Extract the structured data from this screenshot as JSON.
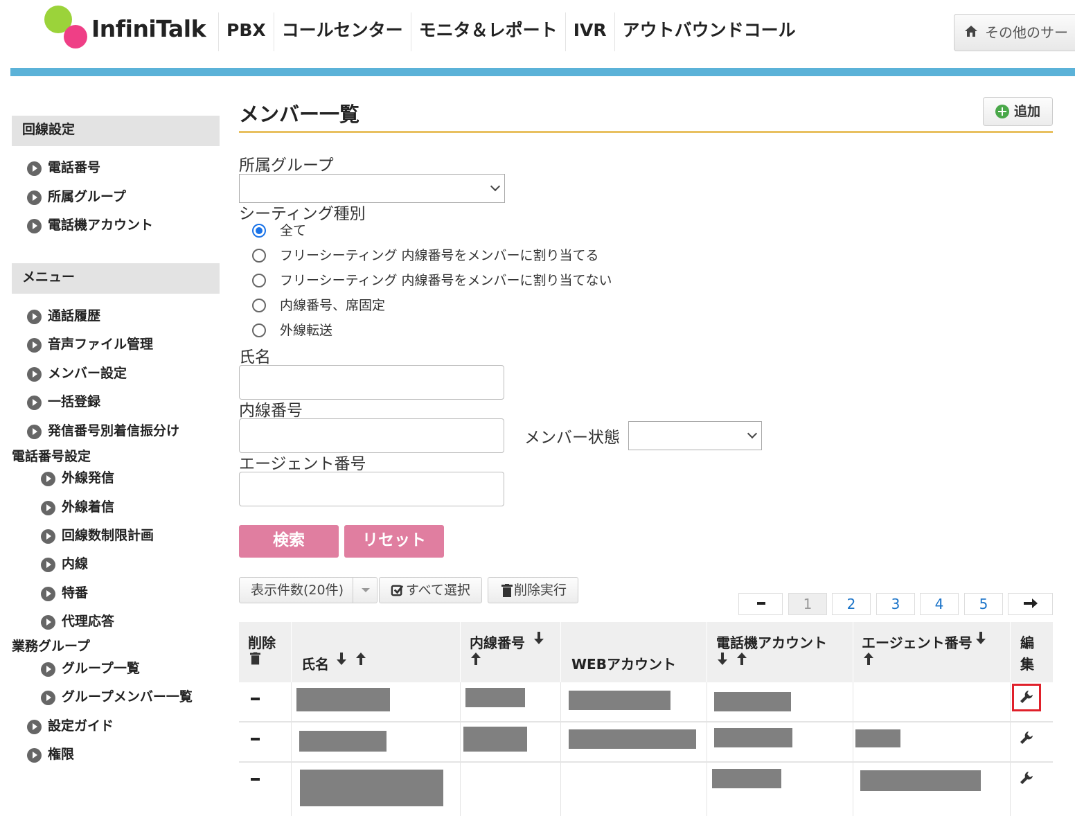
{
  "header": {
    "logo_text": "InfiniTalk",
    "nav": [
      "PBX",
      "コールセンター",
      "モニタ＆レポート",
      "IVR",
      "アウトバウンドコール"
    ],
    "other_services": "その他のサー"
  },
  "sidebar": {
    "section1_title": "回線設定",
    "section1_items": [
      "電話番号",
      "所属グループ",
      "電話機アカウント"
    ],
    "section2_title": "メニュー",
    "menu_items": [
      "通話履歴",
      "音声ファイル管理",
      "メンバー設定",
      "一括登録",
      "発信番号別着信振分け"
    ],
    "group_phone": "電話番号設定",
    "phone_items": [
      "外線発信",
      "外線着信",
      "回線数制限計画",
      "内線",
      "特番",
      "代理応答"
    ],
    "group_work": "業務グループ",
    "work_items": [
      "グループ一覧",
      "グループメンバー一覧"
    ],
    "bottom_items": [
      "設定ガイド",
      "権限"
    ]
  },
  "main": {
    "title": "メンバー一覧",
    "add_label": "追加",
    "group_label": "所属グループ",
    "seating_label": "シーティング種別",
    "seating_options": [
      "全て",
      "フリーシーティング 内線番号をメンバーに割り当てる",
      "フリーシーティング 内線番号をメンバーに割り当てない",
      "内線番号、席固定",
      "外線転送"
    ],
    "seating_selected": 0,
    "name_label": "氏名",
    "ext_label": "内線番号",
    "status_label": "メンバー状態",
    "agent_label": "エージェント番号",
    "search_button": "検索",
    "reset_button": "リセット",
    "display_count": "表示件数(20件)",
    "select_all": "すべて選択",
    "delete_exec": "削除実行",
    "pages": [
      "1",
      "2",
      "3",
      "4",
      "5"
    ],
    "current_page": "1"
  },
  "table": {
    "headers": {
      "delete": "削除",
      "name": "氏名",
      "extension": "内線番号",
      "web_account": "WEBアカウント",
      "phone_account": "電話機アカウント",
      "agent_number": "エージェント番号",
      "edit_1": "編",
      "edit_2": "集"
    }
  },
  "colors": {
    "accent_bar": "#5bb2d8",
    "title_underline": "#e8c060",
    "pink_button": "#e07ea0",
    "highlight": "#e0202a"
  }
}
